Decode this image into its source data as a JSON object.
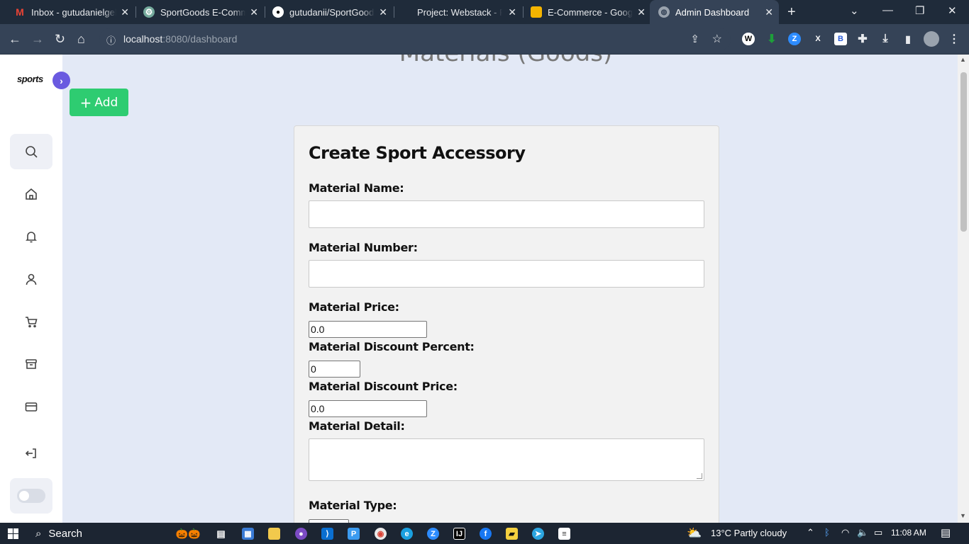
{
  "browser": {
    "tabs": [
      {
        "title": "Inbox - gutudanielgele",
        "icon": "gmail-icon",
        "active": false
      },
      {
        "title": "SportGoods E-Commerce",
        "icon": "chatgpt-icon",
        "active": false
      },
      {
        "title": "gutudanii/SportGoods",
        "icon": "github-icon",
        "active": false
      },
      {
        "title": "Project: Webstack - Po",
        "icon": "blank-icon",
        "active": false
      },
      {
        "title": "E-Commerce - Google",
        "icon": "google-slides-icon",
        "active": false
      },
      {
        "title": "Admin Dashboard",
        "icon": "globe-icon",
        "active": true
      }
    ],
    "url_host": "localhost",
    "url_rest": ":8080/dashboard"
  },
  "app": {
    "logo_text": "sports",
    "page_title": "Materials (Goods)",
    "add_label": "Add"
  },
  "form": {
    "title": "Create Sport Accessory",
    "labels": {
      "name": "Material Name:",
      "number": "Material Number:",
      "price": "Material Price:",
      "discount_percent": "Material Discount Percent:",
      "discount_price": "Material Discount Price:",
      "detail": "Material Detail:",
      "type": "Material Type:"
    },
    "values": {
      "name": "",
      "number": "",
      "price": "0.0",
      "discount_percent": "0",
      "discount_price": "0.0",
      "detail": ""
    }
  },
  "sidebar": {
    "items": [
      "search-icon",
      "home-icon",
      "bell-icon",
      "user-icon",
      "cart-icon",
      "archive-icon",
      "card-icon",
      "logout-icon"
    ]
  },
  "taskbar": {
    "search_label": "Search",
    "weather": "13°C  Partly cloudy",
    "time": "11:08 AM"
  },
  "colors": {
    "accent": "#6a5ae0",
    "add_button": "#2ecc71",
    "page_bg": "#e3e9f6"
  }
}
